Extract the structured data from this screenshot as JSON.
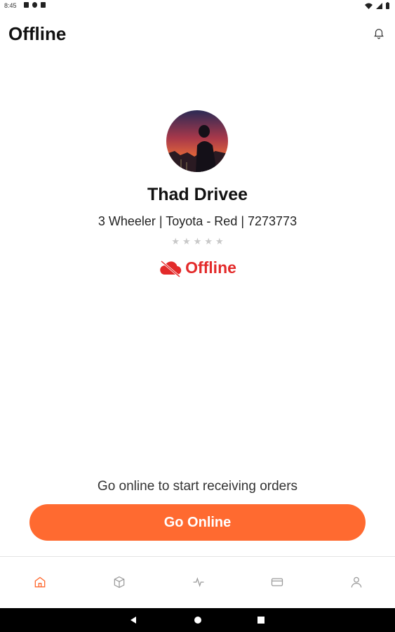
{
  "status_bar": {
    "time": "8:45"
  },
  "header": {
    "title": "Offline"
  },
  "profile": {
    "name": "Thad Drivee",
    "vehicle": "3 Wheeler | Toyota - Red | 7273773",
    "rating": 0,
    "rating_max": 5,
    "status": "Offline"
  },
  "footer": {
    "prompt": "Go online to start receiving orders",
    "button_label": "Go Online"
  },
  "bottom_nav": {
    "items": [
      "home-icon",
      "package-icon",
      "activity-icon",
      "card-icon",
      "user-icon"
    ],
    "active_index": 0
  },
  "colors": {
    "accent": "#ff6a30",
    "offline_red": "#e32a2a",
    "inactive_icon": "#9a9a9a"
  }
}
